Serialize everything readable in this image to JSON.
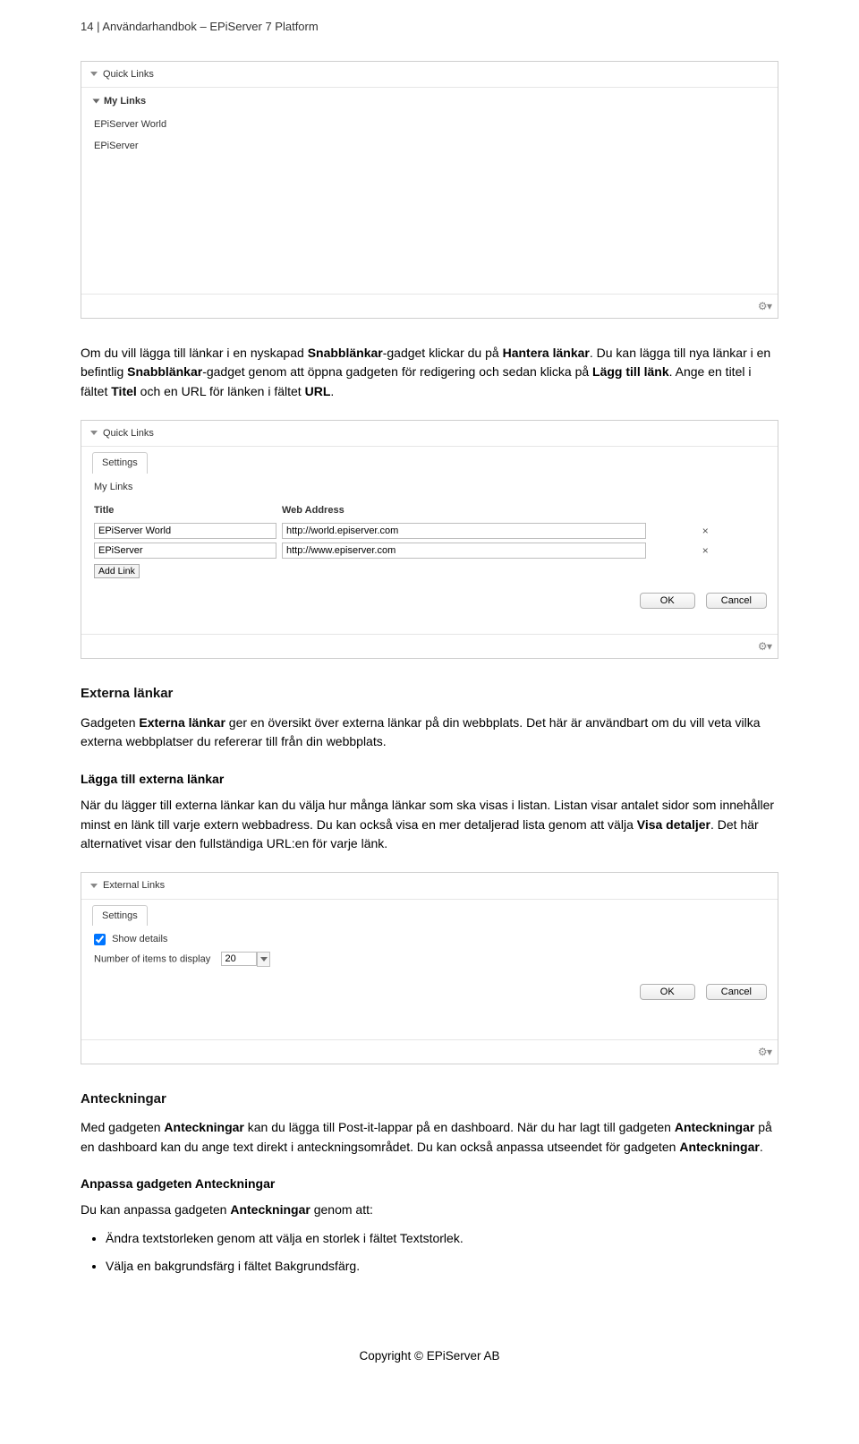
{
  "header": "14 | Användarhandbok – EPiServer 7 Platform",
  "gadget1": {
    "title": "Quick Links",
    "subtitle": "My Links",
    "items": [
      "EPiServer World",
      "EPiServer"
    ]
  },
  "para1": {
    "t1": "Om du vill lägga till länkar i en nyskapad ",
    "b1": "Snabblänkar",
    "t2": "-gadget klickar du på ",
    "b2": "Hantera länkar",
    "t3": ". Du kan lägga till nya länkar i en befintlig ",
    "b3": "Snabblänkar",
    "t4": "-gadget genom att öppna gadgeten för redigering och sedan klicka på ",
    "b4": "Lägg till länk",
    "t5": ". Ange en titel i fältet ",
    "b5": "Titel",
    "t6": " och en URL för länken i fältet ",
    "b6": "URL",
    "t7": "."
  },
  "gadget2": {
    "title": "Quick Links",
    "tab": "Settings",
    "label": "My Links",
    "col_title": "Title",
    "col_addr": "Web Address",
    "rows": [
      {
        "title": "EPiServer World",
        "url": "http://world.episerver.com"
      },
      {
        "title": "EPiServer",
        "url": "http://www.episerver.com"
      }
    ],
    "addlink": "Add Link",
    "ok": "OK",
    "cancel": "Cancel"
  },
  "sect_ext": {
    "heading": "Externa länkar",
    "p1a": "Gadgeten ",
    "p1b": "Externa länkar",
    "p1c": " ger en översikt över externa länkar på din webbplats. Det här är användbart om du vill veta vilka externa webbplatser du refererar till från din webbplats.",
    "sub": "Lägga till externa länkar",
    "p2a": "När du lägger till externa länkar kan du välja hur många länkar som ska visas i listan. Listan visar antalet sidor som innehåller minst en länk till varje extern webbadress. Du kan också visa en mer detaljerad lista genom att välja ",
    "p2b": "Visa detaljer",
    "p2c": ". Det här alternativet visar den fullständiga URL:en för varje länk."
  },
  "gadget3": {
    "title": "External Links",
    "tab": "Settings",
    "show_details": "Show details",
    "num_label": "Number of items to display",
    "num_value": "20",
    "ok": "OK",
    "cancel": "Cancel"
  },
  "sect_ant": {
    "heading": "Anteckningar",
    "p1a": "Med gadgeten ",
    "p1b": "Anteckningar",
    "p1c": " kan du lägga till Post-it-lappar på en dashboard. När du har lagt till gadgeten ",
    "p1d": "Anteckningar",
    "p1e": " på en dashboard kan du ange text direkt i anteckningsområdet. Du kan också anpassa utseendet för gadgeten ",
    "p1f": "Anteckningar",
    "p1g": ".",
    "sub": "Anpassa gadgeten Anteckningar",
    "p2a": "Du kan anpassa gadgeten ",
    "p2b": "Anteckningar",
    "p2c": " genom att:",
    "li1a": "Ändra textstorleken genom att välja en storlek i fältet ",
    "li1b": "Textstorlek",
    "li1c": ".",
    "li2a": "Välja en bakgrundsfärg i fältet ",
    "li2b": "Bakgrundsfärg",
    "li2c": "."
  },
  "copyright": "Copyright © EPiServer AB"
}
